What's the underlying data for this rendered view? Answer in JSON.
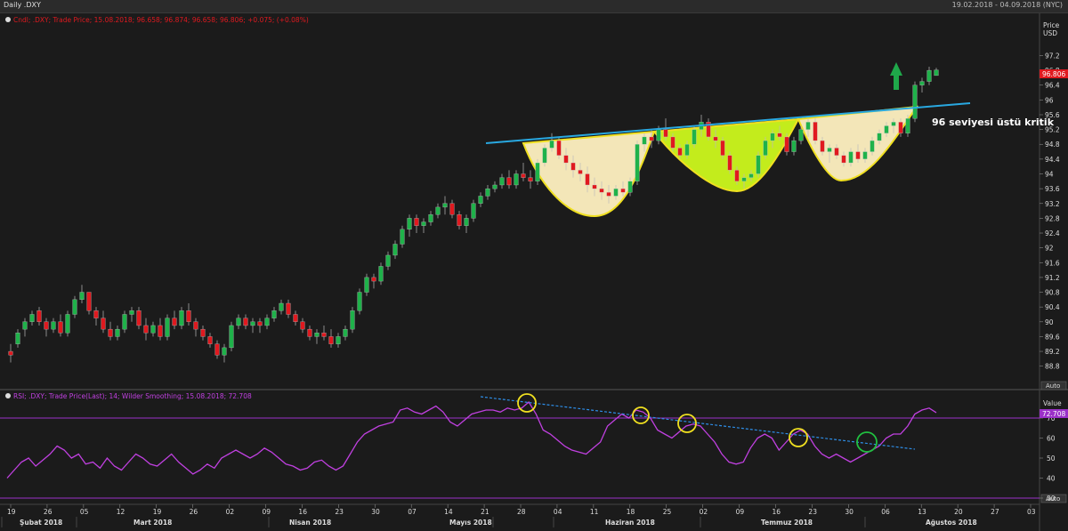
{
  "window": {
    "title": "Daily .DXY",
    "date_range": "19.02.2018 - 04.09.2018 (NYC)"
  },
  "colors": {
    "background": "#1b1b1b",
    "up_candle": "#1fb24a",
    "down_candle": "#e0191f",
    "rsi_line": "#c040e0",
    "level_line": "#9b30c8",
    "neckline": "#29a8e0",
    "rsi_trend": "#2e8ee8",
    "circle_yellow": "#f0e020",
    "circle_green": "#20c040",
    "cup_fill": "#f3e6b8",
    "middle_cup_fill": "#c3ec1c",
    "arrow": "#1fa84a",
    "price_tag": "#e0191f"
  },
  "price_panel": {
    "legend": "Cndl; .DXY; Trade Price; 15.08.2018; 96.658; 96.874; 96.658; 96.806; +0.075; (+0.08%)",
    "axis_title": "Price",
    "axis_unit": "USD",
    "y_ticks": [
      "97.2",
      "96.8",
      "96.4",
      "96",
      "95.6",
      "95.2",
      "94.8",
      "94.4",
      "94",
      "93.6",
      "93.2",
      "92.8",
      "92.4",
      "92",
      "91.6",
      "91.2",
      "90.8",
      "90.4",
      "90",
      "89.6",
      "89.2",
      "88.8"
    ],
    "last_price_label": "96.806",
    "annotation": "96 seviyesi üstü kritik",
    "auto_button": "Auto"
  },
  "rsi_panel": {
    "legend": "RSI; .DXY; Trade Price(Last); 14; Wilder Smoothing; 15.08.2018; 72.708",
    "axis_title": "Value",
    "y_ticks": [
      "70",
      "60",
      "50",
      "40",
      "30"
    ],
    "last_value_label": "72.708",
    "auto_button": "Auto"
  },
  "x_axis": {
    "day_ticks": [
      "19",
      "26",
      "05",
      "12",
      "19",
      "26",
      "02",
      "09",
      "16",
      "23",
      "30",
      "07",
      "14",
      "21",
      "28",
      "04",
      "11",
      "18",
      "25",
      "02",
      "09",
      "16",
      "23",
      "30",
      "06",
      "13",
      "20",
      "27",
      "03"
    ],
    "month_labels": [
      "Şubat 2018",
      "Mart 2018",
      "Nisan 2018",
      "Mayıs 2018",
      "Haziran 2018",
      "Temmuz 2018",
      "Ağustos 2018"
    ]
  },
  "chart_data": {
    "type": "candlestick",
    "ylim": [
      88.6,
      97.5
    ],
    "series": [
      {
        "name": ".DXY",
        "ohlc": [
          [
            89.2,
            89.4,
            88.9,
            89.1
          ],
          [
            89.4,
            89.8,
            89.3,
            89.7
          ],
          [
            89.8,
            90.1,
            89.6,
            90.0
          ],
          [
            90.0,
            90.3,
            89.9,
            90.2
          ],
          [
            90.3,
            90.4,
            89.9,
            90.0
          ],
          [
            90.0,
            90.1,
            89.6,
            89.8
          ],
          [
            89.8,
            90.1,
            89.7,
            90.0
          ],
          [
            90.0,
            90.2,
            89.6,
            89.7
          ],
          [
            89.7,
            90.3,
            89.6,
            90.2
          ],
          [
            90.2,
            90.7,
            90.1,
            90.6
          ],
          [
            90.6,
            91.0,
            90.5,
            90.8
          ],
          [
            90.8,
            90.8,
            90.2,
            90.3
          ],
          [
            90.3,
            90.4,
            89.9,
            90.1
          ],
          [
            90.1,
            90.3,
            89.7,
            89.8
          ],
          [
            89.8,
            90.0,
            89.5,
            89.6
          ],
          [
            89.6,
            89.9,
            89.5,
            89.8
          ],
          [
            89.8,
            90.3,
            89.7,
            90.2
          ],
          [
            90.2,
            90.4,
            90.0,
            90.3
          ],
          [
            90.3,
            90.4,
            89.8,
            89.9
          ],
          [
            89.9,
            90.1,
            89.5,
            89.7
          ],
          [
            89.7,
            90.0,
            89.6,
            89.9
          ],
          [
            89.9,
            90.1,
            89.5,
            89.6
          ],
          [
            89.6,
            90.2,
            89.5,
            90.1
          ],
          [
            90.1,
            90.3,
            89.8,
            89.9
          ],
          [
            89.9,
            90.4,
            89.8,
            90.3
          ],
          [
            90.3,
            90.5,
            89.9,
            90.0
          ],
          [
            90.0,
            90.1,
            89.6,
            89.8
          ],
          [
            89.8,
            89.9,
            89.5,
            89.6
          ],
          [
            89.6,
            89.7,
            89.3,
            89.4
          ],
          [
            89.4,
            89.5,
            89.0,
            89.1
          ],
          [
            89.1,
            89.4,
            88.9,
            89.3
          ],
          [
            89.3,
            90.0,
            89.2,
            89.9
          ],
          [
            89.9,
            90.2,
            89.8,
            90.1
          ],
          [
            90.1,
            90.2,
            89.8,
            89.9
          ],
          [
            89.9,
            90.1,
            89.7,
            90.0
          ],
          [
            90.0,
            90.1,
            89.7,
            89.9
          ],
          [
            89.9,
            90.2,
            89.8,
            90.1
          ],
          [
            90.1,
            90.4,
            90.0,
            90.3
          ],
          [
            90.3,
            90.6,
            90.2,
            90.5
          ],
          [
            90.5,
            90.6,
            90.1,
            90.2
          ],
          [
            90.2,
            90.3,
            89.9,
            90.0
          ],
          [
            90.0,
            90.1,
            89.7,
            89.8
          ],
          [
            89.8,
            89.9,
            89.5,
            89.6
          ],
          [
            89.6,
            89.8,
            89.4,
            89.7
          ],
          [
            89.7,
            89.9,
            89.5,
            89.6
          ],
          [
            89.6,
            89.8,
            89.3,
            89.4
          ],
          [
            89.4,
            89.7,
            89.3,
            89.6
          ],
          [
            89.6,
            89.9,
            89.5,
            89.8
          ],
          [
            89.8,
            90.4,
            89.7,
            90.3
          ],
          [
            90.3,
            90.9,
            90.2,
            90.8
          ],
          [
            90.8,
            91.3,
            90.7,
            91.2
          ],
          [
            91.2,
            91.3,
            90.9,
            91.1
          ],
          [
            91.1,
            91.6,
            91.0,
            91.5
          ],
          [
            91.5,
            91.9,
            91.4,
            91.8
          ],
          [
            91.8,
            92.2,
            91.7,
            92.1
          ],
          [
            92.1,
            92.6,
            92.0,
            92.5
          ],
          [
            92.5,
            92.9,
            92.3,
            92.8
          ],
          [
            92.8,
            92.9,
            92.4,
            92.6
          ],
          [
            92.6,
            92.8,
            92.4,
            92.7
          ],
          [
            92.7,
            93.0,
            92.6,
            92.9
          ],
          [
            92.9,
            93.2,
            92.8,
            93.1
          ],
          [
            93.1,
            93.4,
            92.9,
            93.2
          ],
          [
            93.2,
            93.3,
            92.8,
            92.9
          ],
          [
            92.9,
            93.0,
            92.5,
            92.6
          ],
          [
            92.6,
            92.9,
            92.4,
            92.8
          ],
          [
            92.8,
            93.3,
            92.7,
            93.2
          ],
          [
            93.2,
            93.5,
            93.1,
            93.4
          ],
          [
            93.4,
            93.7,
            93.3,
            93.6
          ],
          [
            93.6,
            93.8,
            93.5,
            93.7
          ],
          [
            93.7,
            94.0,
            93.6,
            93.9
          ],
          [
            93.9,
            94.1,
            93.6,
            93.7
          ],
          [
            93.7,
            94.1,
            93.6,
            94.0
          ],
          [
            94.0,
            94.3,
            93.8,
            93.9
          ],
          [
            93.9,
            94.1,
            93.6,
            93.8
          ],
          [
            93.8,
            94.4,
            93.7,
            94.3
          ],
          [
            94.3,
            94.8,
            94.2,
            94.7
          ],
          [
            94.7,
            95.1,
            94.6,
            94.9
          ],
          [
            94.9,
            95.0,
            94.4,
            94.5
          ],
          [
            94.5,
            94.7,
            94.1,
            94.3
          ],
          [
            94.3,
            94.5,
            93.9,
            94.1
          ],
          [
            94.1,
            94.3,
            93.8,
            94.0
          ],
          [
            94.0,
            94.2,
            93.5,
            93.7
          ],
          [
            93.7,
            93.9,
            93.4,
            93.6
          ],
          [
            93.6,
            93.8,
            93.3,
            93.5
          ],
          [
            93.5,
            93.7,
            93.2,
            93.4
          ],
          [
            93.4,
            93.7,
            93.3,
            93.6
          ],
          [
            93.6,
            93.8,
            93.4,
            93.5
          ],
          [
            93.5,
            93.9,
            93.4,
            93.8
          ],
          [
            93.8,
            94.9,
            93.7,
            94.8
          ],
          [
            94.8,
            95.1,
            94.6,
            95.0
          ],
          [
            95.0,
            95.2,
            94.7,
            94.9
          ],
          [
            94.9,
            95.3,
            94.8,
            95.2
          ],
          [
            95.2,
            95.5,
            94.9,
            95.0
          ],
          [
            95.0,
            95.1,
            94.6,
            94.7
          ],
          [
            94.7,
            94.8,
            94.4,
            94.5
          ],
          [
            94.5,
            94.9,
            94.4,
            94.8
          ],
          [
            94.8,
            95.3,
            94.7,
            95.2
          ],
          [
            95.2,
            95.6,
            95.0,
            95.4
          ],
          [
            95.4,
            95.5,
            94.9,
            95.0
          ],
          [
            95.0,
            95.2,
            94.7,
            94.9
          ],
          [
            94.9,
            95.0,
            94.4,
            94.5
          ],
          [
            94.5,
            94.6,
            94.0,
            94.1
          ],
          [
            94.1,
            94.2,
            93.7,
            93.8
          ],
          [
            93.8,
            94.0,
            93.6,
            93.9
          ],
          [
            93.9,
            94.1,
            93.8,
            94.0
          ],
          [
            94.0,
            94.6,
            93.9,
            94.5
          ],
          [
            94.5,
            95.0,
            94.4,
            94.9
          ],
          [
            94.9,
            95.2,
            94.7,
            95.1
          ],
          [
            95.1,
            95.3,
            94.9,
            95.0
          ],
          [
            95.0,
            95.1,
            94.5,
            94.6
          ],
          [
            94.6,
            95.0,
            94.5,
            94.9
          ],
          [
            94.9,
            95.3,
            94.8,
            95.2
          ],
          [
            95.2,
            95.5,
            95.0,
            95.4
          ],
          [
            95.4,
            95.5,
            94.8,
            94.9
          ],
          [
            94.9,
            95.0,
            94.5,
            94.6
          ],
          [
            94.6,
            94.8,
            94.3,
            94.7
          ],
          [
            94.7,
            94.8,
            94.4,
            94.5
          ],
          [
            94.5,
            94.6,
            94.2,
            94.3
          ],
          [
            94.3,
            94.7,
            94.2,
            94.6
          ],
          [
            94.6,
            94.8,
            94.3,
            94.4
          ],
          [
            94.4,
            94.7,
            94.3,
            94.6
          ],
          [
            94.6,
            95.0,
            94.5,
            94.9
          ],
          [
            94.9,
            95.2,
            94.8,
            95.1
          ],
          [
            95.1,
            95.4,
            95.0,
            95.3
          ],
          [
            95.3,
            95.5,
            95.1,
            95.4
          ],
          [
            95.4,
            95.5,
            95.0,
            95.1
          ],
          [
            95.1,
            95.6,
            95.0,
            95.5
          ],
          [
            95.5,
            96.5,
            95.4,
            96.4
          ],
          [
            96.4,
            96.6,
            96.2,
            96.5
          ],
          [
            96.5,
            96.9,
            96.4,
            96.8
          ],
          [
            96.66,
            96.87,
            96.66,
            96.81
          ]
        ]
      },
      {
        "name": "RSI",
        "values": [
          40,
          44,
          48,
          50,
          46,
          49,
          52,
          56,
          54,
          50,
          52,
          47,
          48,
          45,
          50,
          46,
          44,
          48,
          52,
          50,
          47,
          46,
          49,
          52,
          48,
          45,
          42,
          44,
          47,
          45,
          50,
          52,
          54,
          52,
          50,
          52,
          55,
          53,
          50,
          47,
          46,
          44,
          45,
          48,
          49,
          46,
          44,
          46,
          52,
          58,
          62,
          64,
          66,
          67,
          68,
          74,
          75,
          73,
          72,
          74,
          76,
          73,
          68,
          66,
          69,
          72,
          73,
          74,
          74,
          73,
          75,
          74,
          75,
          78,
          72,
          64,
          62,
          59,
          56,
          54,
          53,
          52,
          55,
          58,
          66,
          69,
          72,
          70,
          74,
          73,
          70,
          64,
          62,
          60,
          63,
          66,
          67,
          66,
          62,
          58,
          52,
          48,
          47,
          48,
          55,
          60,
          62,
          60,
          54,
          58,
          62,
          64,
          62,
          56,
          52,
          50,
          52,
          50,
          48,
          50,
          52,
          54,
          56,
          60,
          62,
          62,
          66,
          72,
          74,
          75,
          72.7
        ]
      },
      {
        "name": "RSI levels",
        "values": [
          70,
          30
        ]
      }
    ]
  }
}
